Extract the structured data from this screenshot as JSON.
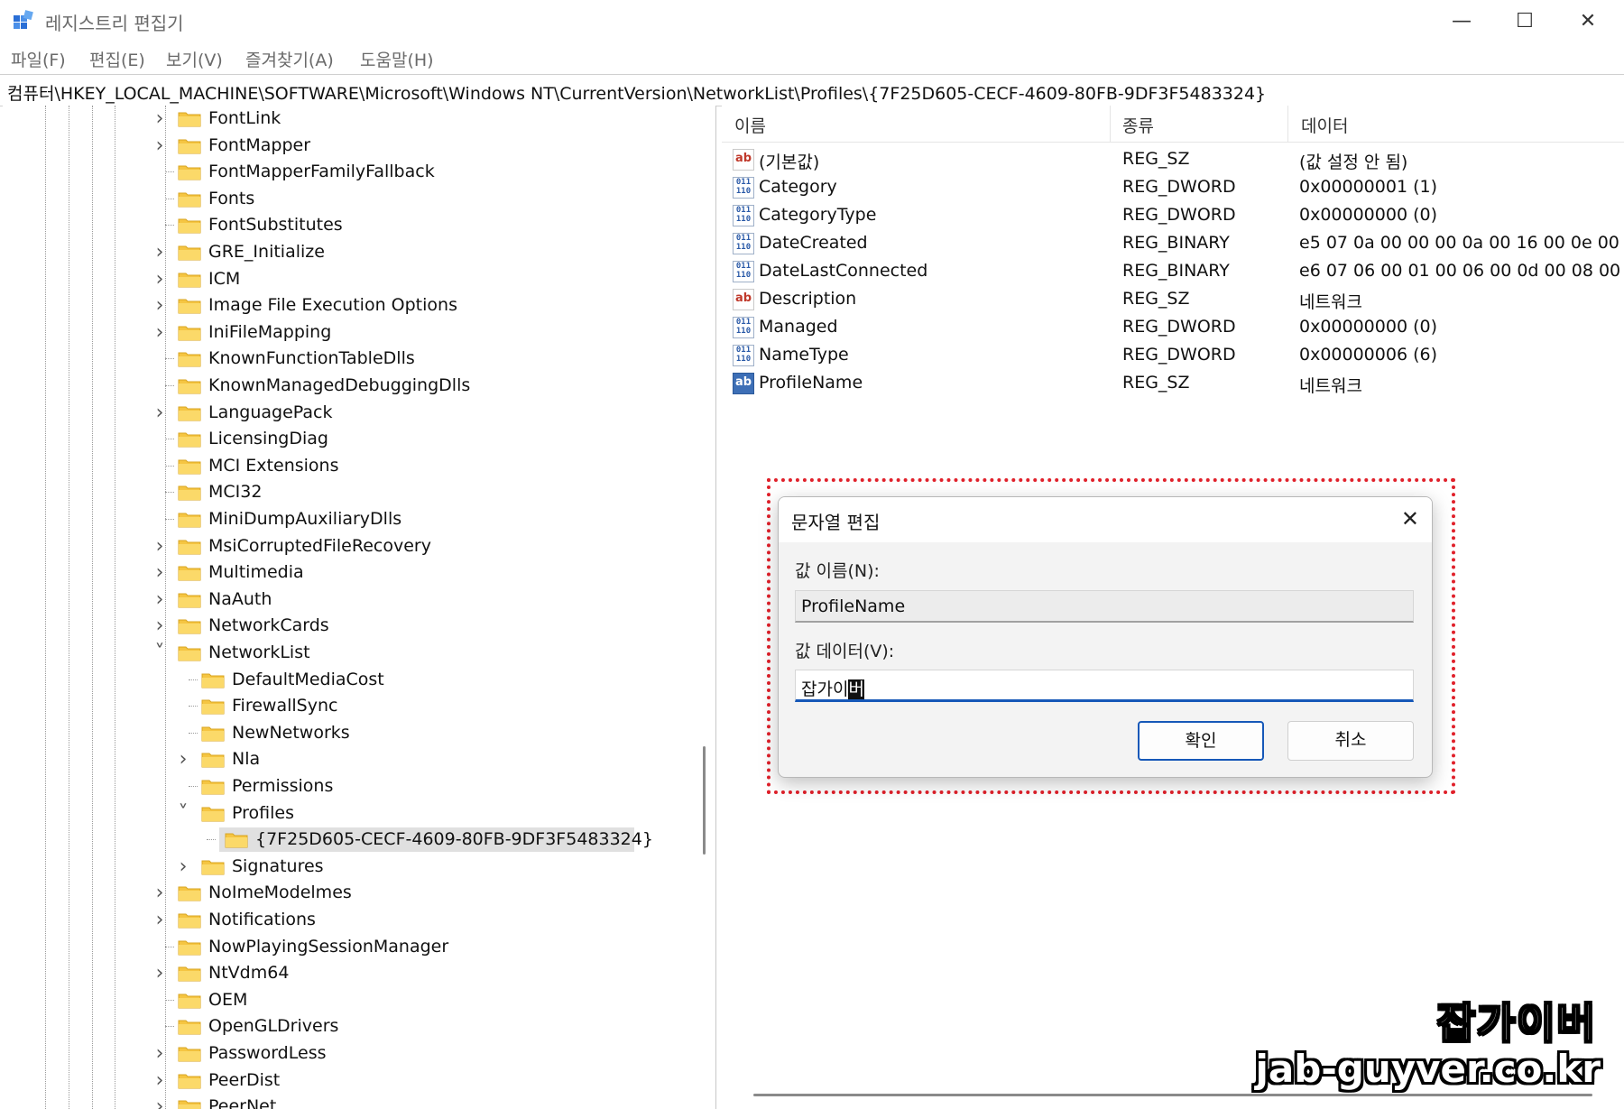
{
  "window": {
    "title": "레지스트리 편집기",
    "controls": {
      "minimize": "—",
      "maximize": "☐",
      "close": "✕"
    }
  },
  "menu": [
    "파일(F)",
    "편집(E)",
    "보기(V)",
    "즐겨찾기(A)",
    "도움말(H)"
  ],
  "address": "컴퓨터\\HKEY_LOCAL_MACHINE\\SOFTWARE\\Microsoft\\Windows NT\\CurrentVersion\\NetworkList\\Profiles\\{7F25D605-CECF-4609-80FB-9DF3F5483324}",
  "tree": [
    {
      "label": "FontLink",
      "expand": ">"
    },
    {
      "label": "FontMapper",
      "expand": ">"
    },
    {
      "label": "FontMapperFamilyFallback",
      "expand": ""
    },
    {
      "label": "Fonts",
      "expand": ""
    },
    {
      "label": "FontSubstitutes",
      "expand": ""
    },
    {
      "label": "GRE_Initialize",
      "expand": ">"
    },
    {
      "label": "ICM",
      "expand": ">"
    },
    {
      "label": "Image File Execution Options",
      "expand": ">"
    },
    {
      "label": "IniFileMapping",
      "expand": ">"
    },
    {
      "label": "KnownFunctionTableDlls",
      "expand": ""
    },
    {
      "label": "KnownManagedDebuggingDlls",
      "expand": ""
    },
    {
      "label": "LanguagePack",
      "expand": ">"
    },
    {
      "label": "LicensingDiag",
      "expand": ""
    },
    {
      "label": "MCI Extensions",
      "expand": ""
    },
    {
      "label": "MCI32",
      "expand": ""
    },
    {
      "label": "MiniDumpAuxiliaryDlls",
      "expand": ""
    },
    {
      "label": "MsiCorruptedFileRecovery",
      "expand": ">"
    },
    {
      "label": "Multimedia",
      "expand": ">"
    },
    {
      "label": "NaAuth",
      "expand": ">"
    },
    {
      "label": "NetworkCards",
      "expand": ">"
    },
    {
      "label": "NetworkList",
      "expand": "v"
    },
    {
      "label": "DefaultMediaCost",
      "expand": ""
    },
    {
      "label": "FirewallSync",
      "expand": ""
    },
    {
      "label": "NewNetworks",
      "expand": ""
    },
    {
      "label": "Nla",
      "expand": ">"
    },
    {
      "label": "Permissions",
      "expand": ""
    },
    {
      "label": "Profiles",
      "expand": "v"
    },
    {
      "label": "{7F25D605-CECF-4609-80FB-9DF3F5483324}",
      "expand": ""
    },
    {
      "label": "Signatures",
      "expand": ">"
    },
    {
      "label": "NoImeModelmes",
      "expand": ">"
    },
    {
      "label": "Notifications",
      "expand": ">"
    },
    {
      "label": "NowPlayingSessionManager",
      "expand": ""
    },
    {
      "label": "NtVdm64",
      "expand": ">"
    },
    {
      "label": "OEM",
      "expand": ""
    },
    {
      "label": "OpenGLDrivers",
      "expand": ""
    },
    {
      "label": "PasswordLess",
      "expand": ">"
    },
    {
      "label": "PeerDist",
      "expand": ">"
    },
    {
      "label": "PeerNet",
      "expand": ">"
    }
  ],
  "list_headers": {
    "name": "이름",
    "type": "종류",
    "data": "데이터"
  },
  "values": [
    {
      "icon": "string-value-icon",
      "name": "(기본값)",
      "type": "REG_SZ",
      "data": "(값 설정 안 됨)"
    },
    {
      "icon": "binary-value-icon",
      "name": "Category",
      "type": "REG_DWORD",
      "data": "0x00000001 (1)"
    },
    {
      "icon": "binary-value-icon",
      "name": "CategoryType",
      "type": "REG_DWORD",
      "data": "0x00000000 (0)"
    },
    {
      "icon": "binary-value-icon",
      "name": "DateCreated",
      "type": "REG_BINARY",
      "data": "e5 07 0a 00 00 00 0a 00 16 00 0e 00 2"
    },
    {
      "icon": "binary-value-icon",
      "name": "DateLastConnected",
      "type": "REG_BINARY",
      "data": "e6 07 06 00 01 00 06 00 0d 00 08 00"
    },
    {
      "icon": "string-value-icon",
      "name": "Description",
      "type": "REG_SZ",
      "data": "네트워크"
    },
    {
      "icon": "binary-value-icon",
      "name": "Managed",
      "type": "REG_DWORD",
      "data": "0x00000000 (0)"
    },
    {
      "icon": "binary-value-icon",
      "name": "NameType",
      "type": "REG_DWORD",
      "data": "0x00000006 (6)"
    },
    {
      "icon": "string-value-icon",
      "name": "ProfileName",
      "type": "REG_SZ",
      "data": "네트워크"
    }
  ],
  "dialog": {
    "title": "문자열 편집",
    "close": "✕",
    "name_label": "값 이름(N):",
    "name_value": "ProfileName",
    "data_label": "값 데이터(V):",
    "data_value_plain": "잡가이",
    "data_value_selected": "버",
    "ok": "확인",
    "cancel": "취소"
  },
  "watermark": {
    "line1": "잡가이버",
    "line2": "jab-guyver.co.kr"
  },
  "colors": {
    "selection_border": "#1658b8",
    "highlight_box": "#e0202a",
    "folder": "#f5c542"
  }
}
